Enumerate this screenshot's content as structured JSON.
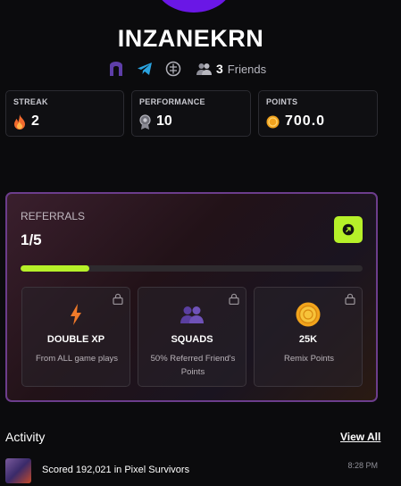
{
  "profile": {
    "username": "INZANEKRN",
    "friends_count": "3",
    "friends_label": "Friends",
    "accent_color": "#6a17e6"
  },
  "stats": [
    {
      "label": "STREAK",
      "value": "2",
      "icon": "fire-icon"
    },
    {
      "label": "PERFORMANCE",
      "value": "10",
      "icon": "medal-icon"
    },
    {
      "label": "POINTS",
      "value": "700.0",
      "icon": "coin-icon"
    }
  ],
  "referrals": {
    "title": "REFERRALS",
    "progress_text": "1/5",
    "progress_fraction": 0.2,
    "share_icon": "arrow-icon",
    "accent_color": "#b6f029",
    "rewards": [
      {
        "title": "DOUBLE XP",
        "desc": "From ALL game plays",
        "icon": "lightning-icon"
      },
      {
        "title": "SQUADS",
        "desc": "50% Referred Friend's Points",
        "icon": "group-icon"
      },
      {
        "title": "25K",
        "desc": "Remix Points",
        "icon": "coin-icon"
      }
    ]
  },
  "activity": {
    "title": "Activity",
    "view_all": "View All",
    "items": [
      {
        "text": "Scored 192,021 in Pixel Survivors",
        "time": "8:28 PM"
      }
    ]
  }
}
